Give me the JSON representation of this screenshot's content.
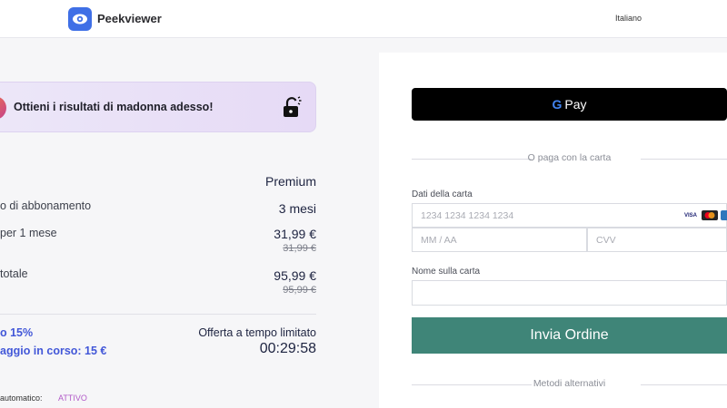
{
  "header": {
    "brand": "Peekviewer",
    "language": "Italiano"
  },
  "promo": {
    "text": "Ottieni i risultati di madonna adesso!"
  },
  "summary": {
    "plan_name": "Premium",
    "rows": [
      {
        "label": "o di abbonamento",
        "value": "3 mesi",
        "old": ""
      },
      {
        "label": "per 1 mese",
        "value": "31,99 €",
        "old": "31,99 €"
      },
      {
        "label": "totale",
        "value": "95,99 €",
        "old": "95,99 €"
      }
    ],
    "discount_percent": "o 15%",
    "discount_saving": "aggio in corso: 15 €",
    "offer_label": "Offerta a tempo limitato",
    "timer": "00:29:58",
    "auto_renew_label": "automatico:",
    "auto_renew_status": "ATTIVO"
  },
  "payment": {
    "gpay_label": "Pay",
    "gpay_g": "G",
    "or_card": "O paga con la carta",
    "card_data_label": "Dati della carta",
    "card_number_placeholder": "1234 1234 1234 1234",
    "expiry_placeholder": "MM / AA",
    "cvv_placeholder": "CVV",
    "name_label": "Nome sulla carta",
    "name_value": "",
    "submit_label": "Invia Ordine",
    "alt_methods": "Metodi alternativi",
    "card_brands": [
      "VISA",
      "MC",
      "AMEX"
    ]
  }
}
